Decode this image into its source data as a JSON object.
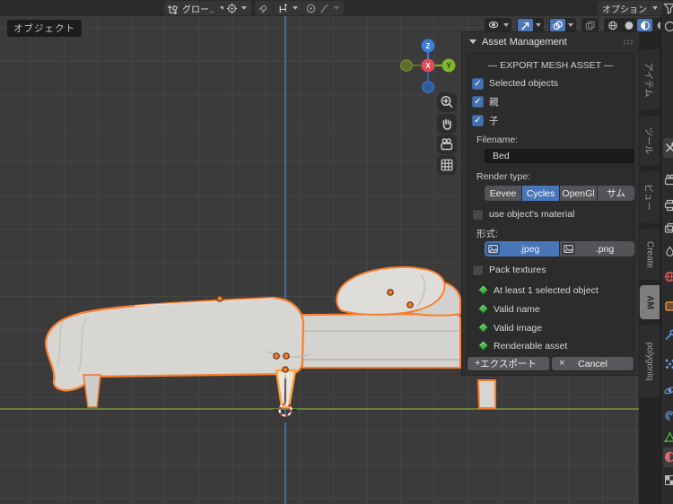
{
  "topbar": {
    "mode_label": "オブジェクト",
    "orientation_label": "グロー..",
    "options_label": "オプション"
  },
  "gizmo": {
    "x_label": "X",
    "y_label": "Y",
    "z_label": "Z"
  },
  "viewport_icons": [
    "zoom-icon",
    "hand-icon",
    "camera-icon",
    "grid-icon"
  ],
  "header_icons": [
    "orientation-icon",
    "pivot-icon",
    "magnet-icon",
    "snap-target-icon",
    "proportional-icon",
    "falloff-icon",
    "visibility-eye-icon",
    "gizmo-toggle-icon",
    "overlays-icon",
    "xray-icon",
    "wireframe-icon",
    "solid-icon",
    "material-preview-icon",
    "rendered-icon"
  ],
  "panel": {
    "title": "Asset Management",
    "section_title": "— EXPORT MESH ASSET —",
    "checkboxes": [
      {
        "label": "Selected objects",
        "checked": true
      },
      {
        "label": "親",
        "checked": true
      },
      {
        "label": "子",
        "checked": true
      }
    ],
    "filename_label": "Filename:",
    "filename_value": "Bed",
    "render_type_label": "Render type:",
    "render_types": [
      {
        "label": "Eevee",
        "selected": false
      },
      {
        "label": "Cycles",
        "selected": true
      },
      {
        "label": "OpenGl",
        "selected": false
      },
      {
        "label": "サム",
        "selected": false
      }
    ],
    "use_material_label": "use object's material",
    "use_material_checked": false,
    "format_label": "形式:",
    "formats": [
      {
        "label": ".jpeg",
        "selected": true
      },
      {
        "label": ".png",
        "selected": false
      }
    ],
    "pack_textures_label": "Pack textures",
    "pack_textures_checked": false,
    "validations": [
      "At least 1 selected object",
      "Valid name",
      "Valid image",
      "Renderable asset"
    ],
    "export_icon": "+",
    "export_label": "エクスポート",
    "cancel_icon": "×",
    "cancel_label": "Cancel"
  },
  "sidebar_tabs": {
    "items": [
      "アイテム",
      "ツール",
      "ビュー",
      "Create",
      "AM",
      "polygoniq"
    ],
    "active": "AM"
  },
  "properties_tabs": [
    "tool",
    "render",
    "output",
    "view-layer",
    "scene",
    "world",
    "object",
    "modifiers",
    "particles",
    "physics",
    "constraints",
    "object-data",
    "material",
    "texture"
  ],
  "colors": {
    "accent_blue": "#4976b8",
    "checkbox_blue": "#4572b0",
    "selection_outline": "#f97e2d",
    "active_outline": "#ffa23a",
    "valid_green": "#3ec23e",
    "axis_green": "#6d8f3e",
    "axis_blue": "#4076b4"
  }
}
